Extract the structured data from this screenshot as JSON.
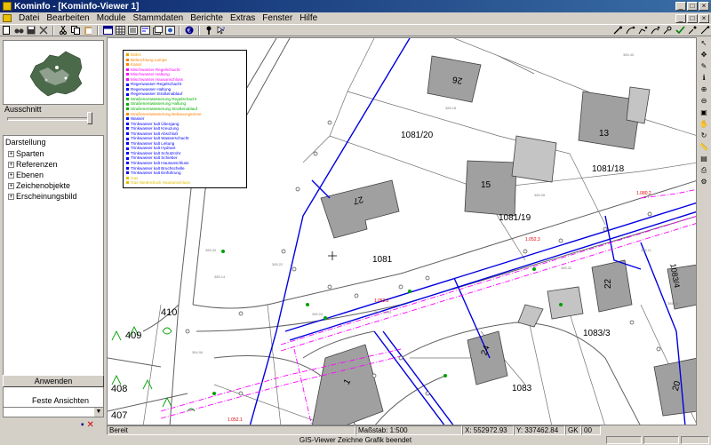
{
  "window": {
    "title": "Kominfo - [Kominfo-Viewer 1]",
    "controls": [
      "_",
      "□",
      "×"
    ]
  },
  "menu": [
    "Datei",
    "Bearbeiten",
    "Module",
    "Stammdaten",
    "Berichte",
    "Extras",
    "Fenster",
    "Hilfe"
  ],
  "left_panel": {
    "ausschnitt_label": "Ausschnitt",
    "tree_header": "Darstellung",
    "tree_items": [
      "Sparten",
      "Referenzen",
      "Ebenen",
      "Zeichenobjekte",
      "Erscheinungsbild"
    ],
    "apply_button": "Anwenden",
    "fixed_views_label": "Feste Ansichten"
  },
  "legend": [
    {
      "label": "Bäkrs",
      "color": "#f0a000"
    },
    {
      "label": "Beleuchtung Lampe",
      "color": "#ff8000"
    },
    {
      "label": "Kanal",
      "color": "#ff8000"
    },
    {
      "label": "Mischwasser Regelschacht",
      "color": "#ff00ff"
    },
    {
      "label": "Mischwasser Haltung",
      "color": "#ff00ff"
    },
    {
      "label": "Mischwasser Hausanschluss",
      "color": "#ff00ff"
    },
    {
      "label": "Regenwasser Regelschacht",
      "color": "#0000ff"
    },
    {
      "label": "Regenwasser Haltung",
      "color": "#0000ff"
    },
    {
      "label": "Regenwasser Straßenablauf",
      "color": "#0000ff"
    },
    {
      "label": "Straßenentwässerung Regelschacht",
      "color": "#00b000"
    },
    {
      "label": "Straßenentwässerung Haltung",
      "color": "#00b000"
    },
    {
      "label": "Straßenentwässerung Straßenablauf",
      "color": "#00b000"
    },
    {
      "label": "Straßenentwässerung Bebauungsrinne",
      "color": "#ff8000"
    },
    {
      "label": "Wasser",
      "color": "#0000ff"
    },
    {
      "label": "Trinkwasser kalt Übergang",
      "color": "#0000ff"
    },
    {
      "label": "Trinkwasser kalt Kreuzung",
      "color": "#0000ff"
    },
    {
      "label": "Trinkwasser kalt Abschluß",
      "color": "#0000ff"
    },
    {
      "label": "Trinkwasser kalt Wasserschacht",
      "color": "#0000ff"
    },
    {
      "label": "Trinkwasser kalt Leitung",
      "color": "#0000ff"
    },
    {
      "label": "Trinkwasser kalt Hydrant",
      "color": "#0000ff"
    },
    {
      "label": "Trinkwasser kalt Schutzrohr",
      "color": "#0000ff"
    },
    {
      "label": "Trinkwasser kalt Schieber",
      "color": "#0000ff"
    },
    {
      "label": "Trinkwasser kalt Hausanschluss",
      "color": "#0000ff"
    },
    {
      "label": "Trinkwasser kalt Bruchschelle",
      "color": "#0000ff"
    },
    {
      "label": "Trinkwasser kalt Einführung",
      "color": "#0000ff"
    },
    {
      "label": "Gas",
      "color": "#e0c000"
    },
    {
      "label": "Gas Niederdruck Hausanschluss",
      "color": "#e0c000"
    }
  ],
  "map_labels": {
    "parcels": [
      "1081/20",
      "1081/18",
      "1081/19",
      "1081",
      "1083/3",
      "1083",
      "410",
      "409",
      "408",
      "407",
      "1083/4"
    ],
    "house_numbers": [
      "26",
      "13",
      "15",
      "27",
      "22",
      "24",
      "1",
      "20"
    ]
  },
  "status": {
    "left": "Bereit",
    "scale": "Maßstab: 1:500",
    "x": "X: 552972.93",
    "y": "Y: 337462.84",
    "gk": "GK",
    "gk_value": "00",
    "message": "GIS-Viewer Zeichne Grafik beendet"
  },
  "colors": {
    "titlebar": "#0a246a",
    "water_line": "#0000ff",
    "sewer_line": "#ff00ff",
    "building": "#a0a0a0"
  }
}
